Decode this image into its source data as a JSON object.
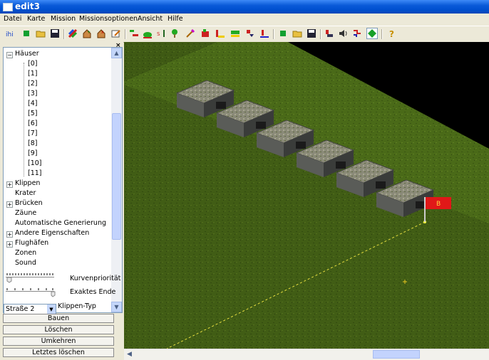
{
  "window": {
    "title": "edit3"
  },
  "menu": [
    "Datei",
    "Karte",
    "Mission",
    "Missionsoptionen",
    "Ansicht",
    "Hilfe"
  ],
  "toolbar_icons": [
    "info-icon",
    "new-icon",
    "open-icon",
    "save-icon",
    "palette-icon",
    "house-add-icon",
    "house-remove-icon",
    "edit-icon",
    "road-icon",
    "terrain-icon",
    "tree-icon",
    "forest-icon",
    "brush-icon",
    "building-icon",
    "fill-icon",
    "slope-icon",
    "level-icon",
    "bridge-icon",
    "new-map-icon",
    "open-map-icon",
    "save-map-icon",
    "unit-icon",
    "sound-icon",
    "path-icon",
    "diamond-icon",
    "help-icon"
  ],
  "tree": {
    "root_label": "Häuser",
    "house_items": [
      "[0]",
      "[1]",
      "[2]",
      "[3]",
      "[4]",
      "[5]",
      "[6]",
      "[7]",
      "[8]",
      "[9]",
      "[10]",
      "[11]"
    ],
    "categories": [
      "Klippen",
      "Krater",
      "Brücken",
      "Zäune",
      "Automatische Generierung",
      "Andere Eigenschaften",
      "Flughäfen",
      "Zonen",
      "Sound"
    ]
  },
  "controls": {
    "curve_priority_label": "Kurvenpriorität",
    "exact_end_label": "Exaktes Ende",
    "cliff_type_label": "Klippen-Typ",
    "street_select_value": "Straße 2"
  },
  "buttons": {
    "build": "Bauen",
    "delete": "Löschen",
    "reverse": "Umkehren",
    "delete_last": "Letztes löschen"
  },
  "map": {
    "flag_label": "B",
    "flag_color": "#e01818",
    "grass_color": "#4a6a18",
    "void_color": "#000000"
  }
}
